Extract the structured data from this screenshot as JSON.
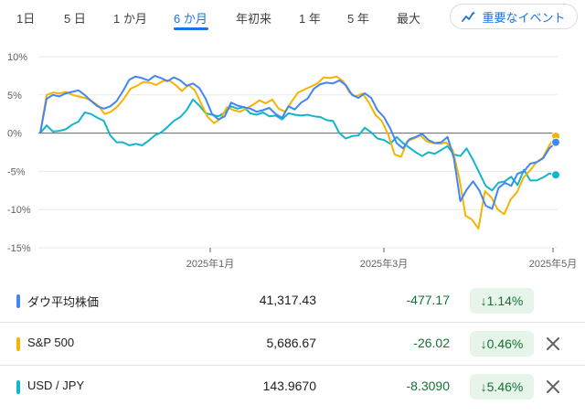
{
  "range_tabs": [
    {
      "label": "1日",
      "active": false
    },
    {
      "label": "5 日",
      "active": false
    },
    {
      "label": "1 か月",
      "active": false
    },
    {
      "label": "6 か月",
      "active": true
    },
    {
      "label": "年初来",
      "active": false
    },
    {
      "label": "1 年",
      "active": false
    },
    {
      "label": "5 年",
      "active": false
    },
    {
      "label": "最大",
      "active": false
    }
  ],
  "events_button": {
    "label": "重要なイベント",
    "icon": "trend-sparkle-icon"
  },
  "chart_data": {
    "type": "line",
    "y_ticks": [
      "10%",
      "5%",
      "0%",
      "-5%",
      "-10%",
      "-15%"
    ],
    "ylim": [
      -15,
      10
    ],
    "x_ticks": [
      "2025年1月",
      "2025年3月",
      "2025年5月"
    ],
    "grid": true,
    "series": [
      {
        "name": "ダウ平均株価",
        "color": "#4285f4",
        "values": [
          0,
          4.5,
          5,
          4.8,
          5.2,
          5.4,
          5.6,
          5,
          4.2,
          3.5,
          3.2,
          3.5,
          4.2,
          5.5,
          7,
          7.4,
          7.2,
          6.9,
          7.5,
          7.2,
          6.8,
          7.3,
          6.9,
          6.2,
          6.5,
          5.9,
          4.5,
          2.5,
          1.8,
          2.2,
          4,
          3.6,
          3.4,
          3.2,
          2.8,
          3,
          3.3,
          2.5,
          2,
          3.5,
          3.1,
          4,
          4.5,
          5.8,
          6.4,
          6.6,
          6.5,
          6.9,
          6.3,
          5,
          4.6,
          5.2,
          4.6,
          3,
          2.1,
          0.6,
          -1.3,
          -2,
          -0.8,
          -0.5,
          -0.1,
          -0.9,
          -1.3,
          -1.2,
          -0.5,
          -3.3,
          -8.9,
          -7.4,
          -6.3,
          -7.5,
          -9.5,
          -9.9,
          -7.2,
          -6.5,
          -6.9,
          -5.3,
          -5,
          -4,
          -3.8,
          -3.3,
          -2,
          -1.2
        ]
      },
      {
        "name": "S&P 500",
        "color": "#f4b400",
        "values": [
          0,
          5,
          5.3,
          5.2,
          5.4,
          5,
          4.8,
          4.6,
          4.2,
          3.6,
          2.5,
          2.8,
          3.5,
          4.5,
          5.8,
          6.2,
          6.7,
          6.6,
          6.3,
          6.8,
          6.9,
          6.3,
          5.5,
          6.3,
          5.6,
          3.8,
          2.1,
          1.3,
          1.9,
          3.4,
          3,
          2.8,
          3.2,
          3.7,
          4.3,
          3.9,
          4.4,
          3.2,
          2.8,
          4.1,
          5.3,
          5.7,
          6.1,
          6.5,
          7.3,
          7.2,
          7.4,
          6.8,
          5.3,
          4.8,
          5.2,
          4,
          2.4,
          1.6,
          -0.2,
          -2.8,
          -3.1,
          -1,
          -0.7,
          -0.3,
          -1.1,
          -1.3,
          -1.4,
          -1.2,
          -2.2,
          -5.8,
          -10.8,
          -11.3,
          -12.5,
          -7.6,
          -8.4,
          -10,
          -10.6,
          -8.7,
          -7.7,
          -5.8,
          -4.9,
          -3.8,
          -3.2,
          -1.6,
          -0.4
        ]
      },
      {
        "name": "USD / JPY",
        "color": "#12b5cb",
        "values": [
          0,
          1,
          0.2,
          0.3,
          0.5,
          1.1,
          1.5,
          2.7,
          2.5,
          2,
          1.6,
          -0.3,
          -1.2,
          -1.2,
          -1.6,
          -1.4,
          -1.6,
          -1,
          -0.3,
          0.1,
          0.8,
          1.6,
          2.1,
          3,
          4.4,
          3.6,
          2.6,
          2.4,
          2.2,
          2.7,
          3.5,
          3.2,
          3.4,
          2.6,
          2.4,
          2.7,
          2.2,
          2.3,
          1.8,
          2.6,
          2.4,
          2.3,
          2.4,
          2.2,
          2.1,
          1.7,
          1.6,
          0,
          -0.7,
          -0.4,
          -0.3,
          0.7,
          0.1,
          -0.7,
          -0.9,
          -1.4,
          -0.5,
          -1.3,
          -1.9,
          -2.5,
          -3,
          -2.5,
          -2.7,
          -2.2,
          -1.7,
          -2.8,
          -3,
          -2,
          -3.5,
          -5.2,
          -6.9,
          -7.5,
          -6.5,
          -6.3,
          -5.7,
          -6.8,
          -4.8,
          -6.2,
          -6.2,
          -5.8,
          -5.3,
          -5.46
        ]
      }
    ]
  },
  "watchlist": [
    {
      "name": "ダウ平均株価",
      "color": "#4285f4",
      "price": "41,317.43",
      "change": "-477.17",
      "percent": "1.14%",
      "removable": false
    },
    {
      "name": "S&P 500",
      "color": "#f4b400",
      "price": "5,686.67",
      "change": "-26.02",
      "percent": "0.46%",
      "removable": true
    },
    {
      "name": "USD / JPY",
      "color": "#12b5cb",
      "price": "143.9670",
      "change": "-8.3090",
      "percent": "5.46%",
      "removable": true
    }
  ]
}
